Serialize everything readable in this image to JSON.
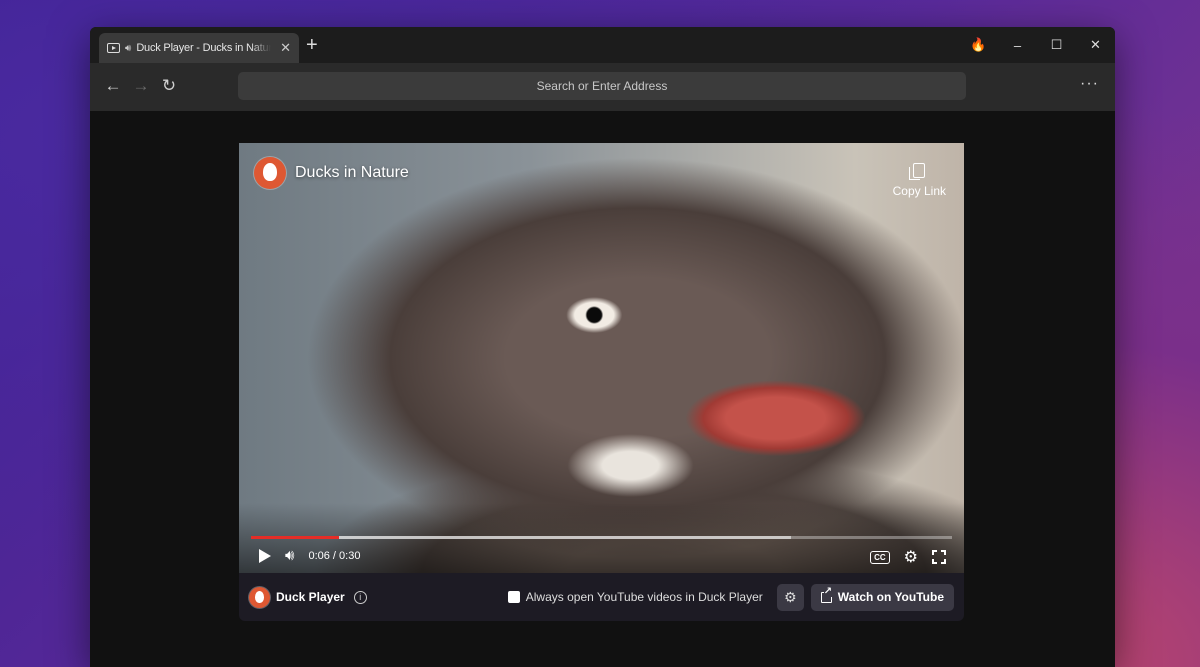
{
  "tab": {
    "title": "Duck Player - Ducks in Nature",
    "close": "✕",
    "new_tab": "+"
  },
  "window_controls": {
    "fire": "🔥",
    "minimize": "–",
    "maximize": "☐",
    "close": "✕"
  },
  "toolbar": {
    "back": "←",
    "forward": "→",
    "reload": "↻",
    "address_placeholder": "Search or Enter Address",
    "menu": "···"
  },
  "player": {
    "video_title": "Ducks in Nature",
    "copy_link_label": "Copy Link",
    "current_time": "0:06",
    "duration": "0:30",
    "time_display": "0:06 / 0:30",
    "progress_played_fraction": 0.125,
    "progress_buffered_fraction": 0.77,
    "cc_label": "CC"
  },
  "bottom_bar": {
    "brand_label": "Duck Player",
    "info_icon": "i",
    "always_open_label": "Always open YouTube videos in Duck Player",
    "always_open_checked": false,
    "settings_icon": "⚙",
    "watch_on_youtube_label": "Watch on YouTube"
  },
  "colors": {
    "accent_red": "#e52d27",
    "ddg_orange": "#de5833"
  }
}
